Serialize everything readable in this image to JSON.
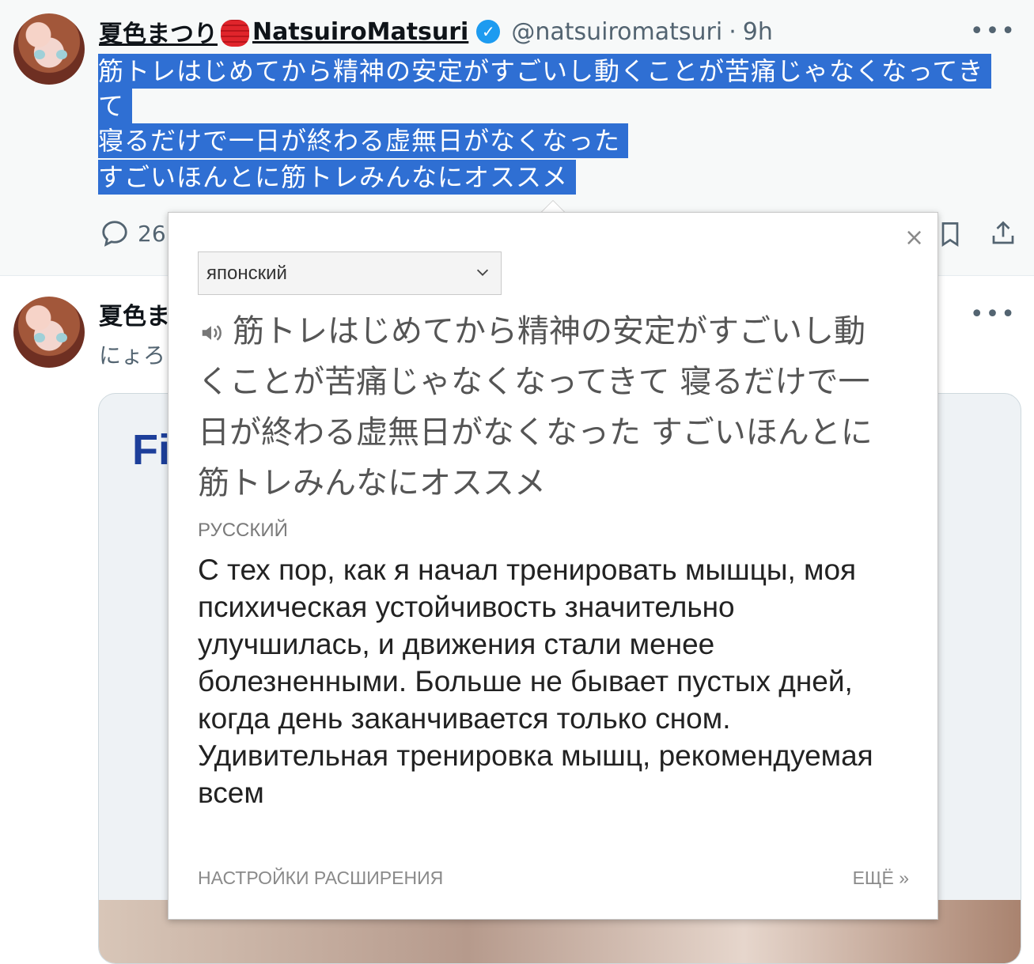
{
  "tweet1": {
    "name": "夏色まつり",
    "name_suffix": "NatsuiroMatsuri",
    "handle": "@natsuiromatsuri",
    "time_sep": "·",
    "time": "9h",
    "more": "•••",
    "text_lines": [
      "筋トレはじめてから精神の安定がすごいし動くことが苦痛じゃなくなってき",
      "て",
      "寝るだけで一日が終わる虚無日がなくなった",
      "すごいほんとに筋トレみんなにオススメ"
    ],
    "reply_count": "26"
  },
  "tweet2": {
    "name": "夏色ま",
    "sub": "にょろ",
    "more": "•••",
    "card_title": "Fi"
  },
  "popup": {
    "close": "×",
    "source_language": "японский",
    "source_text": "筋トレはじめてから精神の安定がすごいし動くことが苦痛じゃなくなってきて 寝るだけで一日が終わる虚無日がなくなった すごいほんとに筋トレみんなにオススメ",
    "target_language_label": "РУССКИЙ",
    "translation": "С тех пор, как я начал тренировать мышцы, моя психическая устойчивость значительно улучшилась, и движения стали менее болезненными. Больше не бывает пустых дней, когда день заканчивается только сном. Удивительная тренировка мышц, рекомендуемая всем",
    "settings_link": "НАСТРОЙКИ РАСШИРЕНИЯ",
    "more_link": "ЕЩЁ »"
  },
  "colors": {
    "selection": "#2f6fd3",
    "verified": "#1d9bf0",
    "muted": "#536471"
  }
}
